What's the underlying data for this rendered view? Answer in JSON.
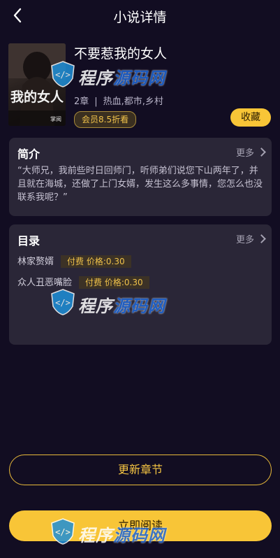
{
  "header": {
    "title": "小说详情"
  },
  "book": {
    "title": "不要惹我的女人",
    "cover_text": "我的女人",
    "cover_publisher": "掌阅",
    "chapters_count": "2章",
    "genres": "热血,都市,乡村",
    "member_discount": "会员8.5折看",
    "collect_label": "收藏"
  },
  "intro": {
    "heading": "简介",
    "more_label": "更多",
    "text": "“大师兄，我前些时日回师门，听师弟们说您下山两年了，并且就在海城，还做了上门女婿，发生这么多事情，您怎么也没联系我呢？”"
  },
  "catalog": {
    "heading": "目录",
    "more_label": "更多",
    "chapters": [
      {
        "name": "林家赘婿",
        "price": "付费 价格:0.30"
      },
      {
        "name": "众人丑恶嘴脸",
        "price": "付费 价格:0.30"
      }
    ]
  },
  "actions": {
    "update_label": "更新章节",
    "read_label": "立即阅读"
  },
  "watermark": {
    "text_a": "程序",
    "text_b": "源码网"
  },
  "colors": {
    "accent": "#f8c537",
    "background": "#120d22",
    "card": "#2a2637"
  }
}
